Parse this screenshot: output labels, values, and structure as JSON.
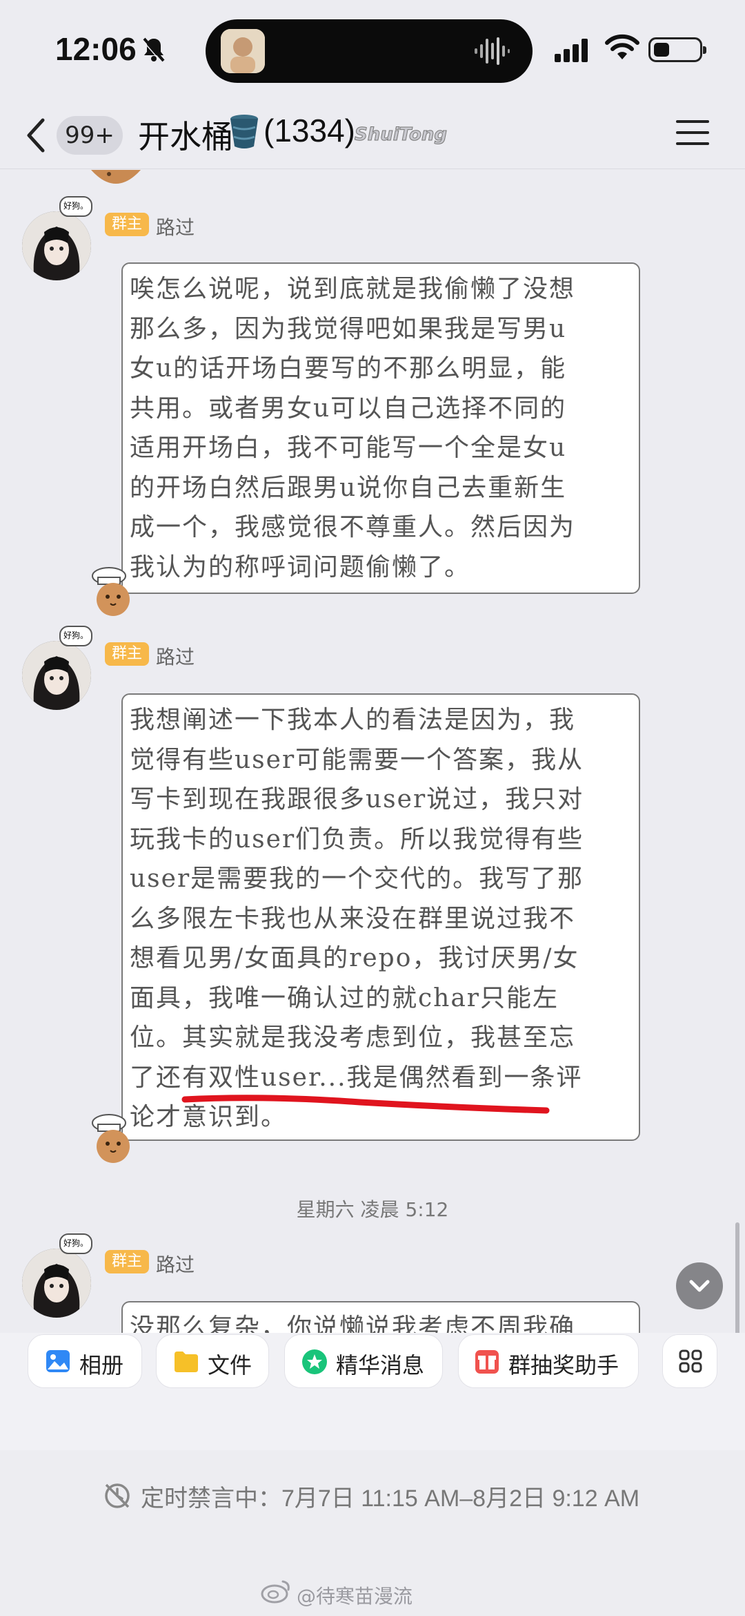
{
  "status_bar": {
    "time": "12:06"
  },
  "header": {
    "unread_badge": "99+",
    "group_name": "开水桶",
    "member_count": "(1334)",
    "group_tag": "ShuiTong"
  },
  "messages": [
    {
      "role": "群主",
      "sender": "路过",
      "avatar_tag": "好狗。",
      "lines": [
        "唉怎么说呢，说到底就是我偷懒了没想",
        "那么多，因为我觉得吧如果我是写男u",
        "女u的话开场白要写的不那么明显，能",
        "共用。或者男女u可以自己选择不同的",
        "适用开场白，我不可能写一个全是女u",
        "的开场白然后跟男u说你自己去重新生",
        "成一个，我感觉很不尊重人。然后因为",
        "我认为的称呼词问题偷懒了。"
      ]
    },
    {
      "role": "群主",
      "sender": "路过",
      "avatar_tag": "好狗。",
      "lines": [
        "我想阐述一下我本人的看法是因为，我",
        "觉得有些user可能需要一个答案，我从",
        "写卡到现在我跟很多user说过，我只对",
        "玩我卡的user们负责。所以我觉得有些",
        "user是需要我的一个交代的。我写了那",
        "么多限左卡我也从来没在群里说过我不",
        "想看见男/女面具的repo，我讨厌男/女",
        "面具，我唯一确认过的就char只能左",
        "位。其实就是我没考虑到位，我甚至忘",
        "了还有双性user...我是偶然看到一条评",
        "论才意识到。"
      ]
    },
    {
      "role": "群主",
      "sender": "路过",
      "avatar_tag": "好狗。",
      "lines": [
        "没那么复杂，你说懒说我考虑不周我确"
      ]
    }
  ],
  "timestamp": "星期六 凌晨 5:12",
  "shortcuts": [
    {
      "label": "相册",
      "icon": "photo-icon"
    },
    {
      "label": "文件",
      "icon": "folder-icon"
    },
    {
      "label": "精华消息",
      "icon": "star-icon"
    },
    {
      "label": "群抽奖助手",
      "icon": "gift-icon"
    }
  ],
  "mute_notice": "定时禁言中：7月7日 11:15 AM–8月2日 9:12 AM",
  "watermark": "@待寒苗漫流",
  "colors": {
    "role_badge": "#f7b84a",
    "underline": "#e0141e",
    "star_icon": "#19c47a",
    "gift_icon": "#f0524e",
    "photo_icon": "#2f88f5",
    "folder_icon": "#f6c028"
  }
}
